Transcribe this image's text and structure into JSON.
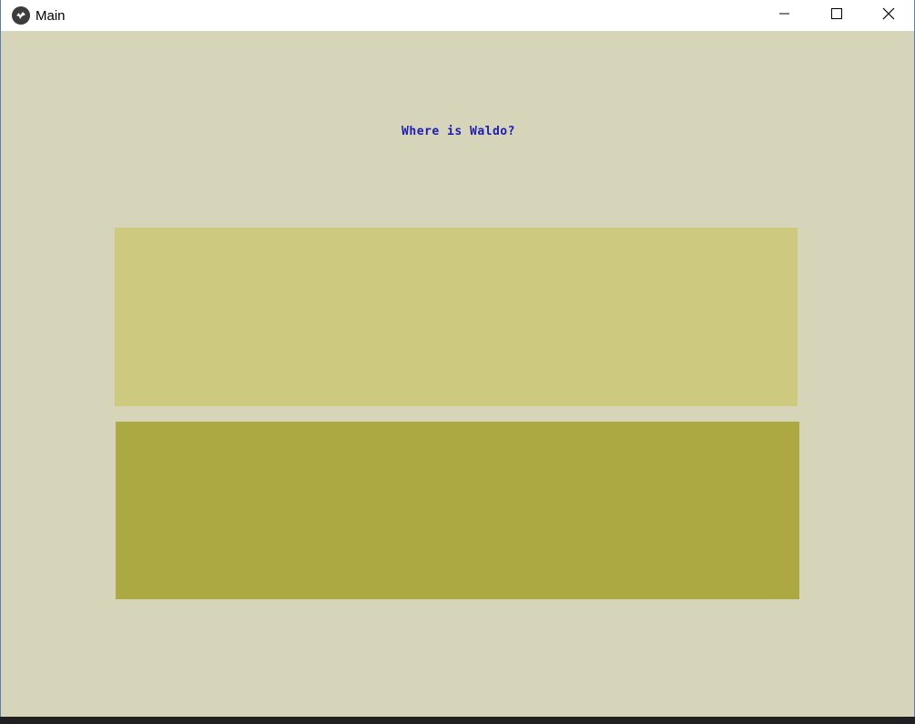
{
  "window": {
    "title": "Main",
    "icon": "kivy-app-icon",
    "controls": {
      "minimize": "minimize-icon",
      "maximize": "maximize-icon",
      "close": "close-icon"
    }
  },
  "content": {
    "question": "Where is Waldo?",
    "question_color": "#1d1db5",
    "background_color": "#d7d5b9",
    "top_panel_color": "#cdc97e",
    "bottom_panel_color": "#aca842"
  }
}
